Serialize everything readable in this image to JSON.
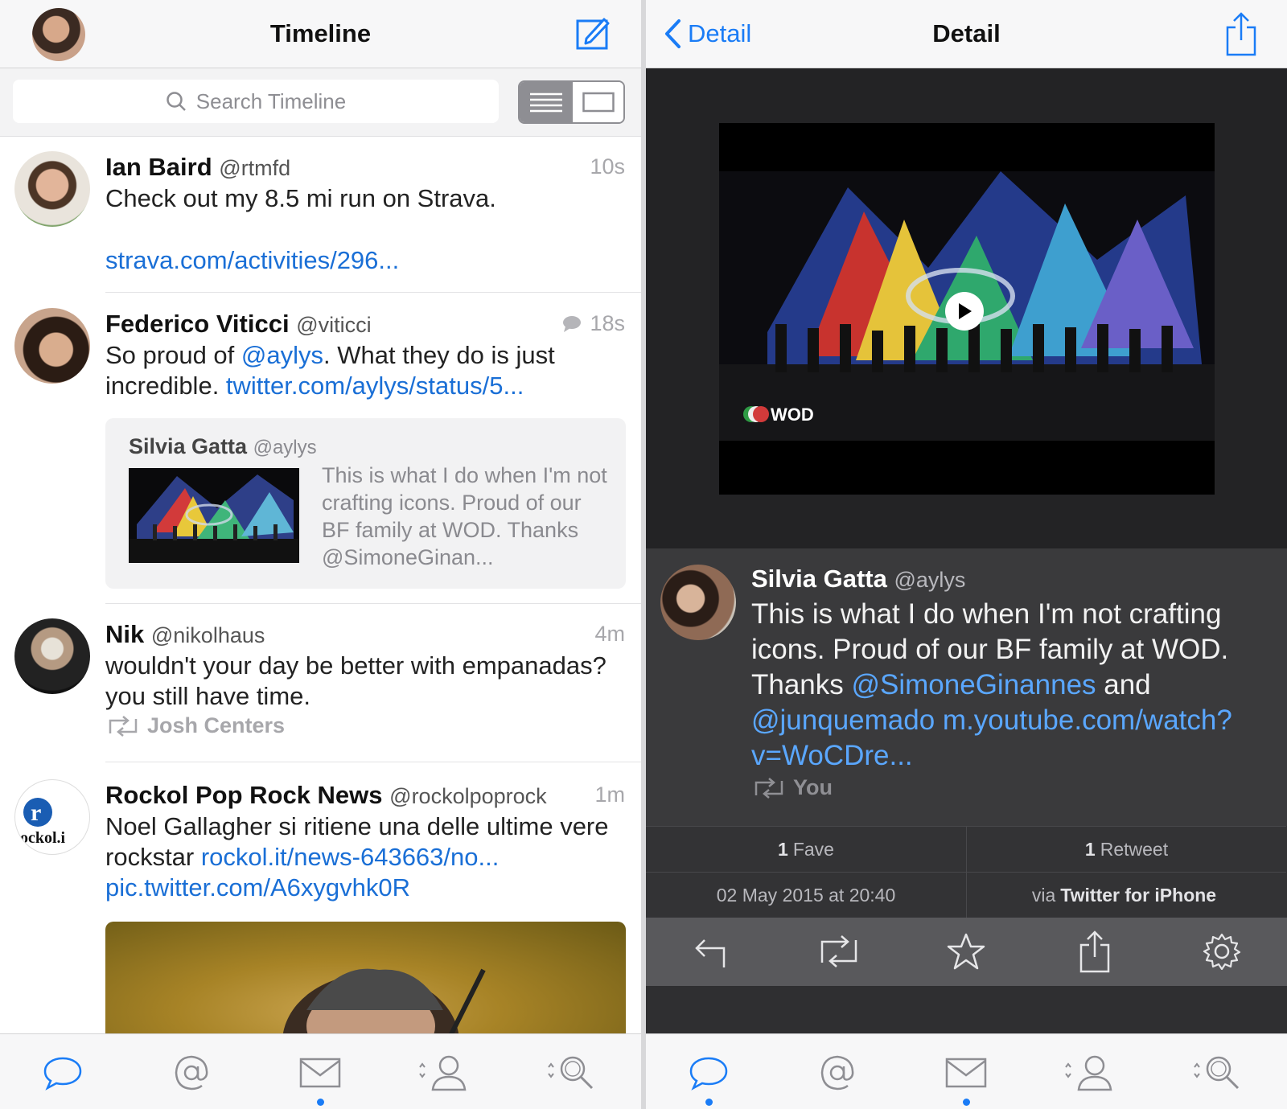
{
  "timeline": {
    "title": "Timeline",
    "search_placeholder": "Search Timeline",
    "tweets": [
      {
        "name": "Ian Baird",
        "handle": "@rtmfd",
        "time": "10s",
        "text": "Check out my 8.5 mi run on Strava.",
        "link": "strava.com/activities/296..."
      },
      {
        "name": "Federico Viticci",
        "handle": "@viticci",
        "time": "18s",
        "text_a": "So proud of ",
        "mention": "@aylys",
        "text_b": ". What they do is just incredible. ",
        "link": "twitter.com/aylys/status/5...",
        "quote": {
          "name": "Silvia Gatta",
          "handle": "@aylys",
          "text": "This is what I do when I'm not crafting icons. Proud of our BF family at WOD. Thanks @SimoneGinan..."
        }
      },
      {
        "name": "Nik",
        "handle": "@nikolhaus",
        "time": "4m",
        "text": "wouldn't your day be better with empanadas? you still have time.",
        "retweeted_by": "Josh Centers"
      },
      {
        "name": "Rockol Pop Rock News",
        "handle": "@rockolpoprock",
        "time": "1m",
        "text": "Noel Gallagher si ritiene una delle ultime vere rockstar ",
        "link": "rockol.it/news-643663/no...",
        "link2": "pic.twitter.com/A6xygvhk0R",
        "avatar_text": "ockol.i"
      }
    ]
  },
  "detail": {
    "back_label": "Detail",
    "title": "Detail",
    "tweet": {
      "name": "Silvia Gatta",
      "handle": "@aylys",
      "text": "This is what I do when I'm not crafting icons. Proud of our BF family at WOD. Thanks ",
      "mention1": "@SimoneGinannes",
      "and": " and ",
      "mention2": "@junquemado",
      "link": "m.youtube.com/watch?v=WoCDre...",
      "retweeted_by": "You"
    },
    "stats": {
      "faves_count": "1",
      "faves_label": "Fave",
      "retweets_count": "1",
      "retweets_label": "Retweet",
      "date": "02 May 2015 at 20:40",
      "via_prefix": "via",
      "via_app": "Twitter for iPhone"
    }
  },
  "colors": {
    "accent": "#1a7cf6",
    "link": "#1a6fd6",
    "dark_link": "#5aa7ff"
  },
  "icons": [
    "compose-icon",
    "search-icon",
    "list-view-icon",
    "card-view-icon",
    "conversation-icon",
    "back-chevron-icon",
    "share-icon",
    "play-icon",
    "retweet-icon",
    "reply-icon",
    "star-icon",
    "gear-icon",
    "timeline-tab-icon",
    "mentions-tab-icon",
    "messages-tab-icon",
    "profile-tab-icon",
    "search-tab-icon"
  ]
}
